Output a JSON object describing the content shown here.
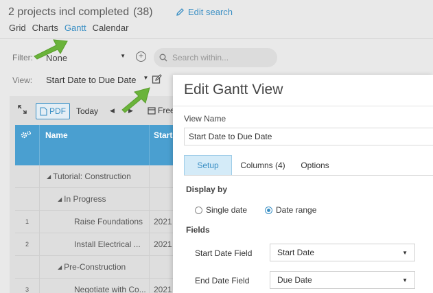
{
  "header": {
    "title": "2 projects incl completed",
    "count": "(38)",
    "edit_search": "Edit search"
  },
  "nav": {
    "tabs": [
      "Grid",
      "Charts",
      "Gantt",
      "Calendar"
    ],
    "active": "Gantt"
  },
  "filter": {
    "label": "Filter:",
    "value": "None",
    "search_placeholder": "Search within..."
  },
  "view": {
    "label": "View:",
    "value": "Start Date to Due Date"
  },
  "toolbar": {
    "pdf": "PDF",
    "today": "Today",
    "freeze": "Free"
  },
  "table": {
    "columns": [
      "Name",
      "Start"
    ],
    "rows": [
      {
        "num": "",
        "name": "Tutorial: Construction",
        "indent": 0,
        "group": true,
        "start": ""
      },
      {
        "num": "",
        "name": "In Progress",
        "indent": 1,
        "group": true,
        "start": ""
      },
      {
        "num": "1",
        "name": "Raise Foundations",
        "indent": 2,
        "group": false,
        "start": "2021"
      },
      {
        "num": "2",
        "name": "Install Electrical ...",
        "indent": 2,
        "group": false,
        "start": "2021"
      },
      {
        "num": "",
        "name": "Pre-Construction",
        "indent": 1,
        "group": true,
        "start": ""
      },
      {
        "num": "3",
        "name": "Negotiate with Co...",
        "indent": 2,
        "group": false,
        "start": "2021"
      }
    ]
  },
  "modal": {
    "title": "Edit Gantt View",
    "view_name_label": "View Name",
    "view_name_value": "Start Date to Due Date",
    "tabs": {
      "setup": "Setup",
      "columns": "Columns (4)",
      "options": "Options"
    },
    "display_by_label": "Display by",
    "single_date": "Single date",
    "date_range": "Date range",
    "fields_label": "Fields",
    "start_field_label": "Start Date Field",
    "start_field_value": "Start Date",
    "end_field_label": "End Date Field",
    "end_field_value": "Due Date"
  },
  "colors": {
    "accent": "#3a8fc4",
    "header_blue": "#4a9fd0",
    "arrow_green": "#6ab33a"
  }
}
